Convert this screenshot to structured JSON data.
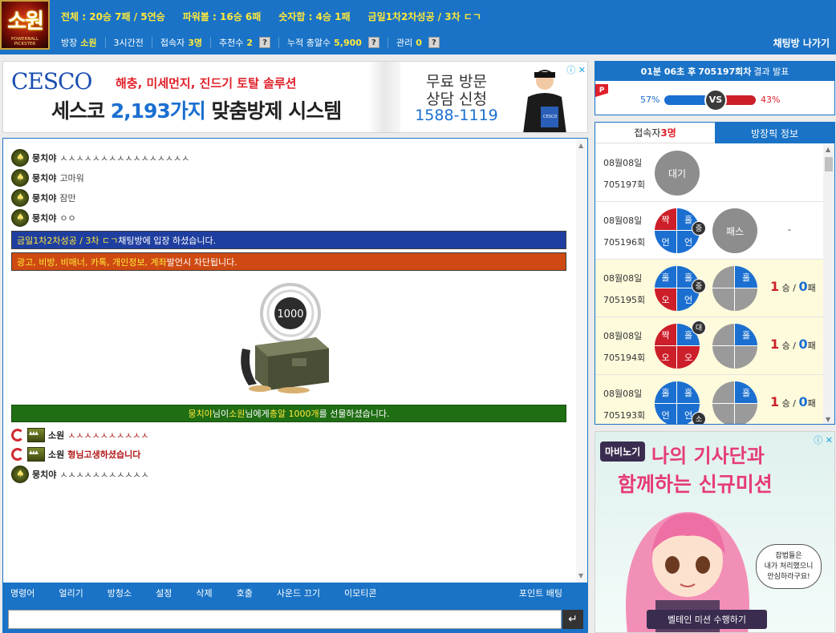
{
  "header": {
    "logo_text": "소원",
    "logo_sub": "POWERBALL PICKSTER",
    "stats": {
      "total": "전체 : 20승 7패 / 5연승",
      "powerball": "파워볼 : 16승 6패",
      "number_sum": "숫자합 : 4승 1패",
      "pick": "금일1차2차성공 / 3차 ㄷㄱ"
    },
    "info": {
      "host_label": "방장",
      "host_value": "소원",
      "hours": "3시간전",
      "users_label": "접속자",
      "users_value": "3명",
      "recommend_label": "추천수",
      "recommend_value": "2",
      "bullets_label": "누적 총알수",
      "bullets_value": "5,900",
      "manage_label": "관리",
      "manage_value": "0",
      "help_mark": "?"
    },
    "exit_label": "채팅방 나가기"
  },
  "ad_top": {
    "brand": "CESCO",
    "line1": "해충, 미세먼지, 진드기 토탈 솔루션",
    "line2_prefix": "세스코 ",
    "line2_highlight": "2,193가지",
    "line2_suffix": " 맞춤방제 시스템",
    "right1": "무료 방문",
    "right2": "상담 신청",
    "right3": "1588-1119",
    "badge": "CESCO"
  },
  "chat": {
    "messages": [
      {
        "nick": "뭉치야",
        "text": "ㅅㅅㅅㅅㅅㅅㅅㅅㅅㅅㅅㅅㅅㅅㅅㅅ"
      },
      {
        "nick": "뭉치야",
        "text": "고마워"
      },
      {
        "nick": "뭉치야",
        "text": "잠만"
      },
      {
        "nick": "뭉치야",
        "text": "ㅇㅇ"
      }
    ],
    "notice_blue_highlight": "금일1차2차성공 / 3차 ㄷㄱ",
    "notice_blue_suffix": " 채팅방에 입장 하셨습니다.",
    "notice_orange_highlight": "광고, 비방, 비매너, 카톡, 개인정보, 계좌",
    "notice_orange_suffix": " 발언시 차단됩니다.",
    "gift_amount": "1000",
    "gift_from": "뭉치야",
    "gift_mid1": " 님이 ",
    "gift_to": "소원",
    "gift_mid2": " 님에게 ",
    "gift_item": "총알 1000개",
    "gift_end": "를 선물하셨습니다.",
    "messages2": [
      {
        "nick": "소원",
        "text": "ㅅㅅㅅㅅㅅㅅㅅㅅㅅㅅ"
      },
      {
        "nick": "소원",
        "text": "형님고생하셨습니다"
      },
      {
        "nick": "뭉치야",
        "text": "ㅅㅅㅅㅅㅅㅅㅅㅅㅅㅅㅅ"
      }
    ],
    "menu": [
      "명령어",
      "얼리기",
      "방청소",
      "설정",
      "삭제",
      "호출",
      "사운드 끄기",
      "이모티콘"
    ],
    "point_bet": "포인트 배팅",
    "send_symbol": "↵"
  },
  "result": {
    "countdown": "01분 06초 후",
    "round": "705197회차",
    "label": "결과 발표",
    "p_badge": "P",
    "vs": "VS",
    "left_pct": "57%",
    "right_pct": "43%",
    "left_value": 57,
    "right_value": 43
  },
  "tabs": {
    "users_label": "접속자 ",
    "users_count": "3명",
    "pick_label": "방장픽 정보"
  },
  "history": [
    {
      "date": "08월08일",
      "round": "705197회",
      "state": "대기"
    },
    {
      "date": "08월08일",
      "round": "705196회",
      "q": [
        "짝",
        "홀",
        "언",
        "언"
      ],
      "qc": [
        "r",
        "b",
        "b",
        "b"
      ],
      "badge": "중",
      "pick": "패스",
      "result": "-"
    },
    {
      "date": "08월08일",
      "round": "705195회",
      "q": [
        "홀",
        "홀",
        "오",
        "언"
      ],
      "qc": [
        "b",
        "b",
        "r",
        "b"
      ],
      "badge": "중",
      "pick_q": "홀",
      "win": "1",
      "sep": " 승 / ",
      "lose": "0",
      "unit": "패"
    },
    {
      "date": "08월08일",
      "round": "705194회",
      "q": [
        "짝",
        "홀",
        "오",
        "오"
      ],
      "qc": [
        "r",
        "b",
        "r",
        "r"
      ],
      "badge": "대",
      "pick_q": "홀",
      "win": "1",
      "sep": " 승 / ",
      "lose": "0",
      "unit": "패"
    },
    {
      "date": "08월08일",
      "round": "705193회",
      "q": [
        "홀",
        "홀",
        "언",
        "언"
      ],
      "qc": [
        "b",
        "b",
        "b",
        "b"
      ],
      "badge": "소",
      "pick_q": "홀",
      "win": "1",
      "sep": " 승 / ",
      "lose": "0",
      "unit": "패"
    }
  ],
  "ad_right": {
    "logo": "마비노기",
    "title1": "나의 기사단과",
    "title2": "함께하는 신규미션",
    "bubble1": "잡법들은",
    "bubble2": "내가 처리했으니",
    "bubble3": "안심하라구요!",
    "cta": "벨테인 미션 수행하기"
  },
  "colors": {
    "header_blue": "#1a73c6",
    "highlight_yellow": "#ffe93a",
    "notice_blue": "#1f3fa0",
    "notice_orange": "#cf4a12",
    "gift_green": "#1f6e14",
    "odd_blue": "#1b6fd0",
    "even_red": "#cc1f2a"
  }
}
